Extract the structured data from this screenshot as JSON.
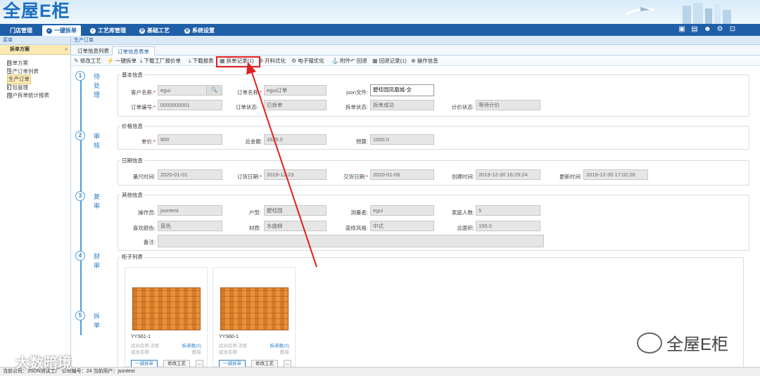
{
  "header": {
    "logo": "全屋E柜"
  },
  "nav": {
    "tabs": [
      "门店管理",
      "一键拆单",
      "工艺库管理",
      "基础工艺",
      "系统设置"
    ]
  },
  "sidebar": {
    "title": "菜单",
    "section": "拆单方案",
    "items": [
      "拆单方案",
      "生产订单列表",
      "生产订单",
      "打包管理",
      "用户拆单统计报表"
    ],
    "selected": "生产订单"
  },
  "breadcrumb": "生产订单",
  "page_tabs": [
    "订单信息列表",
    "订单信息表单"
  ],
  "toolbar": [
    "修改工艺",
    "一键拆单",
    "下载工厂报价单",
    "下载报表",
    "拆单记录(1)",
    "开料优化",
    "电子锯优化",
    "附件",
    "回退",
    "回退记录(1)",
    "操作信息"
  ],
  "steps": [
    {
      "num": "1",
      "label": "待处理"
    },
    {
      "num": "2",
      "label": "审核"
    },
    {
      "num": "3",
      "label": "复审"
    },
    {
      "num": "4",
      "label": "财审"
    },
    {
      "num": "5",
      "label": "拆单"
    }
  ],
  "sections": {
    "basic": "基本信息",
    "price": "价格信息",
    "date": "日期信息",
    "other": "其他信息",
    "cabinet": "柜子列表"
  },
  "basic": {
    "customer_label": "客户名称:",
    "customer": "egui",
    "order_name_label": "订单名称:",
    "order_name": "egui订单",
    "json_label": "json文件:",
    "json": "碧桂园凤凰城-全",
    "order_no_label": "订单编号:",
    "order_no": "0000000001",
    "order_status_label": "订单状态:",
    "order_status": "已拆单",
    "split_status_label": "拆单状态:",
    "split_status": "拆单成功",
    "price_status_label": "计价状态:",
    "price_status": "等待计价"
  },
  "price": {
    "unit_label": "单价:",
    "unit": "800",
    "total_label": "总金额:",
    "total": "1625.0",
    "budget_label": "预算:",
    "budget": "1000.0"
  },
  "date": {
    "measure_label": "量尺时间:",
    "measure": "2020-01-01",
    "order_label": "订货日期:",
    "order": "2019-12-23",
    "deliver_label": "交货日期:",
    "deliver": "2020-01-06",
    "created_label": "创建时间:",
    "created": "2019-12-30 16:29:24",
    "updated_label": "更新时间:",
    "updated": "2019-12-30 17:02:26"
  },
  "other": {
    "operator_label": "操作员:",
    "operator": "jsontest",
    "house_label": "户型:",
    "house": "碧桂园",
    "surveyor_label": "测量者:",
    "surveyor": "egui",
    "family_label": "家庭人数:",
    "family": "5",
    "color_label": "喜欢颜色:",
    "color": "蓝色",
    "material_label": "材质:",
    "material": "水曲柳",
    "style_label": "装修风格:",
    "style": "中式",
    "area_label": "总面积:",
    "area": "150.0",
    "note_label": "备注:",
    "note": ""
  },
  "cabinets": [
    {
      "name": "YYS61-1",
      "meta1": "房间名称:次卧",
      "meta2": "组合名称:",
      "count": "拆单数(0)",
      "del": "删除",
      "btn1": "一键拆单",
      "btn2": "修改工艺",
      "btn3": "..."
    },
    {
      "name": "YYS60-1",
      "meta1": "房间名称:次卧",
      "meta2": "组合名称:",
      "count": "拆单数(0)",
      "del": "删除",
      "btn1": "一键拆单",
      "btn2": "修改工艺",
      "btn3": "..."
    }
  ],
  "footer": "当前公司：JSON测试工厂   公司编号：24   当前用户：jsontest",
  "watermark": {
    "left": "大数暗境",
    "right": "全屋E柜"
  },
  "colors": {
    "nav": "#1f5fa8",
    "highlight": "#e02020",
    "step": "#4a9fe0"
  }
}
